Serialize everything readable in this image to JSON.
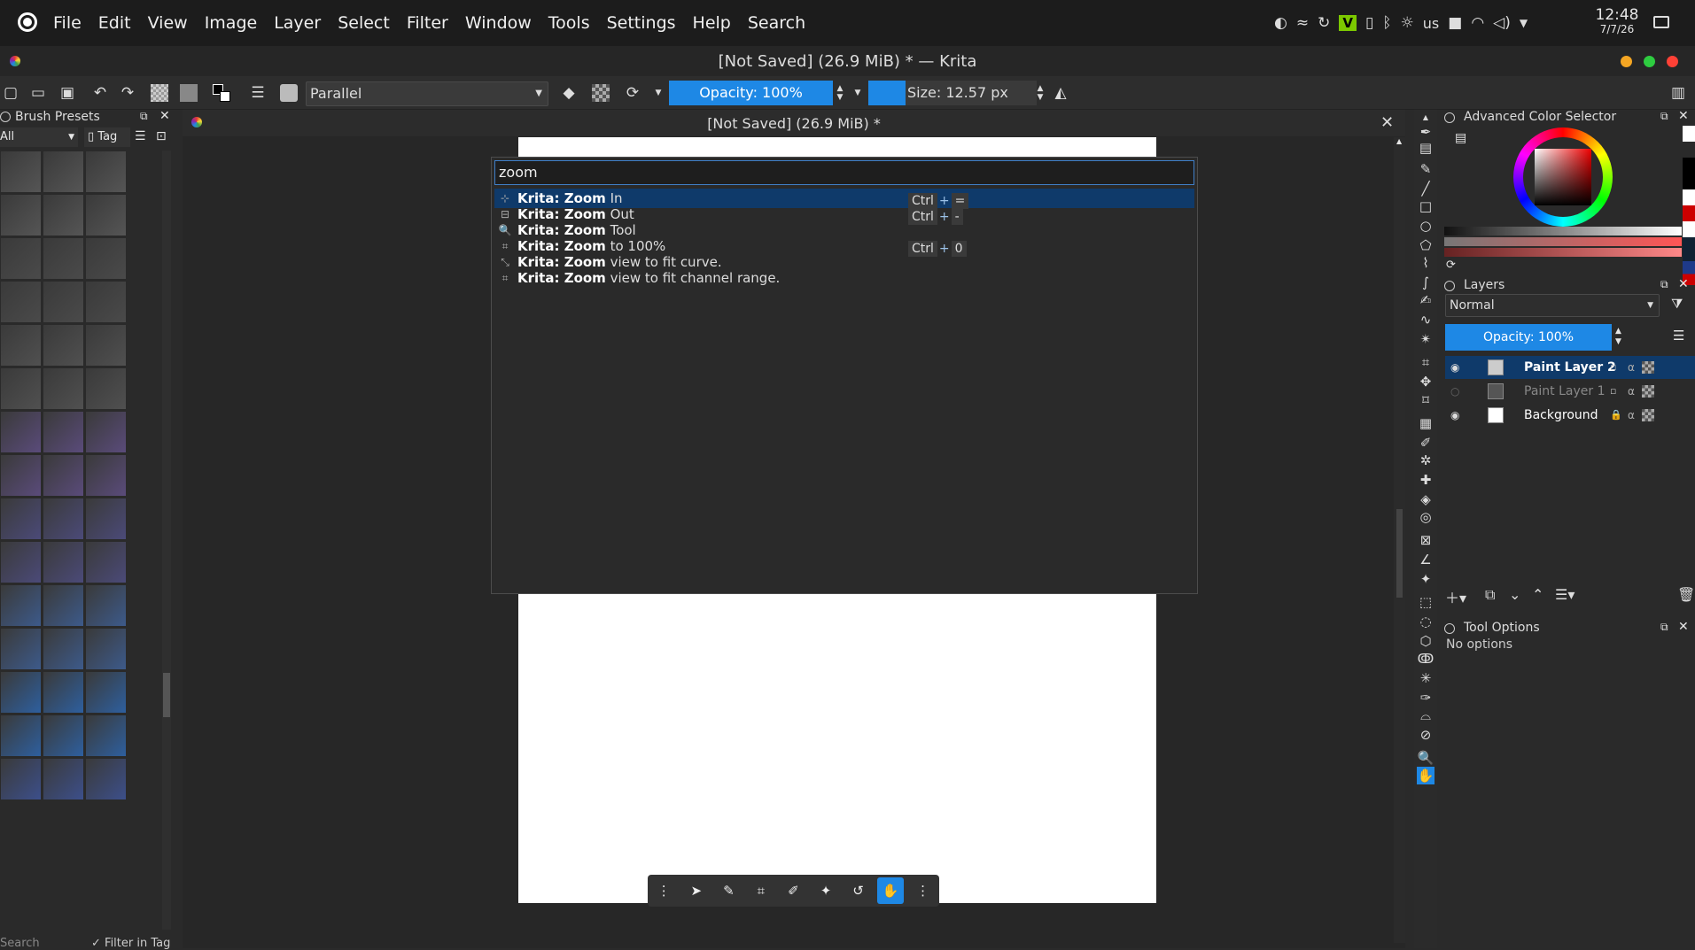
{
  "menubar": {
    "items": [
      "File",
      "Edit",
      "View",
      "Image",
      "Layer",
      "Select",
      "Filter",
      "Window",
      "Tools",
      "Settings",
      "Help",
      "Search"
    ],
    "tray": {
      "keyboard": "us",
      "clock_time": "12:48",
      "clock_date": "7/7/26"
    }
  },
  "window": {
    "title": "[Not Saved] (26.9 MiB) * — Krita"
  },
  "toolbar": {
    "brush_preset": "Parallel",
    "opacity": "Opacity: 100%",
    "size": "Size: 12.57 px"
  },
  "brush_presets": {
    "title": "Brush Presets",
    "filter_value": "All",
    "tag_label": "Tag",
    "search_placeholder": "Search",
    "filter_in_tag": "Filter in Tag"
  },
  "document": {
    "tab_title": "[Not Saved]  (26.9 MiB) *"
  },
  "command_palette": {
    "query": "zoom",
    "results": [
      {
        "prefix": "Krita: ",
        "match": "Zoom",
        "rest": " In",
        "shortcut": [
          "Ctrl",
          "+",
          "="
        ],
        "icon": "zoom-in-icon",
        "selected": true
      },
      {
        "prefix": "Krita: ",
        "match": "Zoom",
        "rest": " Out",
        "shortcut": [
          "Ctrl",
          "+",
          "-"
        ],
        "icon": "zoom-out-icon",
        "selected": false
      },
      {
        "prefix": "Krita: ",
        "match": "Zoom",
        "rest": " Tool",
        "shortcut": [],
        "icon": "magnifier-icon",
        "selected": false
      },
      {
        "prefix": "Krita: ",
        "match": "Zoom",
        "rest": " to 100%",
        "shortcut": [
          "Ctrl",
          "+",
          "0"
        ],
        "icon": "zoom-100-icon",
        "selected": false
      },
      {
        "prefix": "Krita: ",
        "match": "Zoom",
        "rest": " view to fit curve.",
        "shortcut": [],
        "icon": "fit-curve-icon",
        "selected": false
      },
      {
        "prefix": "Krita: ",
        "match": "Zoom",
        "rest": " view to fit channel range.",
        "shortcut": [],
        "icon": "fit-range-icon",
        "selected": false
      }
    ]
  },
  "color_selector": {
    "title": "Advanced Color Selector"
  },
  "layers": {
    "title": "Layers",
    "blend_mode": "Normal",
    "opacity": "Opacity: 100%",
    "items": [
      {
        "name": "Paint Layer 2",
        "active": true
      },
      {
        "name": "Paint Layer 1",
        "active": false
      },
      {
        "name": "Background",
        "active": false
      }
    ]
  },
  "tool_options": {
    "title": "Tool Options",
    "body": "No options"
  },
  "colors": {
    "accent": "#1e88e5",
    "selection": "#0f3a6a"
  }
}
